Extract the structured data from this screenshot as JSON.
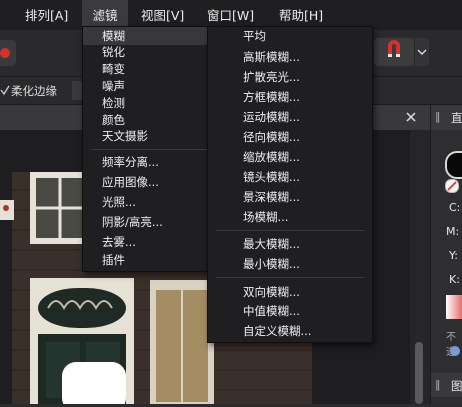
{
  "menubar": {
    "items": [
      {
        "label": "排列[A]"
      },
      {
        "label": "滤镜"
      },
      {
        "label": "视图[V]"
      },
      {
        "label": "窗口[W]"
      },
      {
        "label": "帮助[H]"
      }
    ]
  },
  "options_bar": {
    "feather_label": "柔化边缘"
  },
  "filters_menu": {
    "items": [
      "模糊",
      "锐化",
      "畸变",
      "噪声",
      "检测",
      "颜色",
      "天文摄影"
    ],
    "items2": [
      "频率分离...",
      "应用图像...",
      "光照...",
      "阴影/高亮...",
      "去雾...",
      "插件"
    ]
  },
  "blur_submenu": {
    "group1": [
      "平均",
      "高斯模糊...",
      "扩散亮光...",
      "方框模糊...",
      "运动模糊...",
      "径向模糊...",
      "缩放模糊...",
      "镜头模糊...",
      "景深模糊...",
      "场模糊..."
    ],
    "group2": [
      "最大模糊...",
      "最小模糊..."
    ],
    "group3": [
      "双向模糊...",
      "中值模糊...",
      "自定义模糊..."
    ]
  },
  "right_panel": {
    "tab_label": "直",
    "channels": [
      "C:",
      "M:",
      "Y:",
      "K:"
    ],
    "opacity_label": "不透",
    "bottom_tab_label": "图"
  },
  "colors": {
    "menu_bg": "#1f1f22",
    "highlight": "#38383b",
    "accent_red": "#d8302c"
  }
}
